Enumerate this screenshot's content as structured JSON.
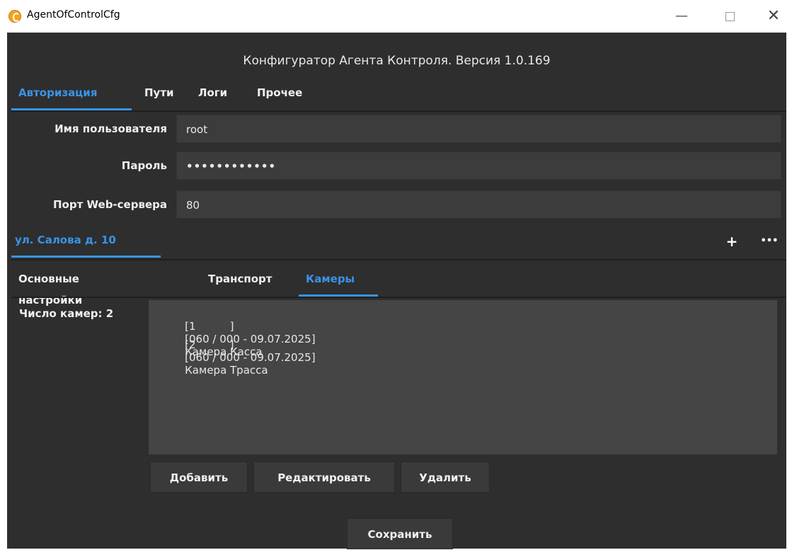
{
  "window": {
    "title": "AgentOfControlCfg",
    "minimize": "—",
    "close": "✕"
  },
  "app": {
    "title": "Конфигуратор Агента Контроля. Версия 1.0.169"
  },
  "main_tabs": [
    {
      "label": "Авторизация",
      "active": true
    },
    {
      "label": "Пути",
      "active": false
    },
    {
      "label": "Логи",
      "active": false
    },
    {
      "label": "Прочее",
      "active": false
    }
  ],
  "auth": {
    "username_label": "Имя пользователя",
    "username_value": "root",
    "password_label": "Пароль",
    "password_value": "••••••••••••",
    "port_label": "Порт Web-сервера",
    "port_value": "80"
  },
  "location_tab": {
    "label": "ул. Салова д. 10",
    "add": "+",
    "more": "•••"
  },
  "sub_tabs": [
    {
      "label": "Основные настройки",
      "active": false
    },
    {
      "label": "Транспорт",
      "active": false
    },
    {
      "label": "Камеры",
      "active": true
    }
  ],
  "cameras": {
    "count_label": "Число камер: 2",
    "items": [
      {
        "index": "[1",
        "close": "]",
        "info": "[060 / 000 - 09.07.2025]",
        "name": "Камера Касса"
      },
      {
        "index": "[2",
        "close": "]",
        "info": "[060 / 000 - 09.07.2025]",
        "name": "Камера Трасса"
      }
    ]
  },
  "buttons": {
    "add": "Добавить",
    "edit": "Редактировать",
    "delete": "Удалить",
    "save": "Сохранить"
  },
  "colors": {
    "accent": "#3a94e8",
    "background": "#2e2e2e"
  }
}
